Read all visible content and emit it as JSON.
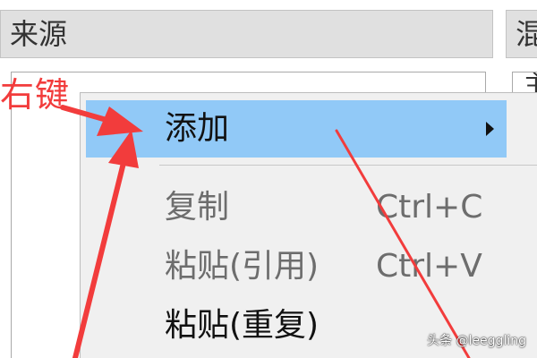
{
  "panels": {
    "left_header": "来源",
    "right_header": "混",
    "right_field_text": "主"
  },
  "annotation": {
    "label": "右键",
    "color": "#f23c3c"
  },
  "context_menu": {
    "items": [
      {
        "label": "添加",
        "shortcut": "",
        "state": "highlighted",
        "has_submenu": true
      },
      {
        "label": "复制",
        "shortcut": "Ctrl+C",
        "state": "disabled",
        "has_submenu": false
      },
      {
        "label": "粘贴(引用)",
        "shortcut": "Ctrl+V",
        "state": "disabled",
        "has_submenu": false
      },
      {
        "label": "粘贴(重复)",
        "shortcut": "",
        "state": "enabled",
        "has_submenu": false
      }
    ],
    "highlight_color": "#91c9f7",
    "background_color": "#f0f0f0"
  },
  "watermark": "头条 @leeggling",
  "icons": {
    "submenu_arrow": "chevron-right-icon",
    "annotation_arrows": "red-arrow-icon"
  }
}
